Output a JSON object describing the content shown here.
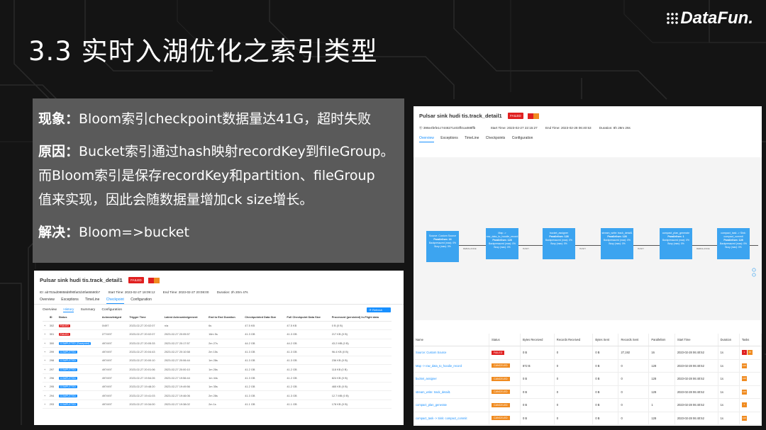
{
  "title": "3.3 实时入湖优化之索引类型",
  "logo": "DataFun.",
  "textbox": {
    "l1_label": "现象：",
    "l1_text": "Bloom索引checkpoint数据量达41G，超时失败",
    "l2_label": "原因：",
    "l2_text": "Bucket索引通过hash映射recordKey到fileGroup。",
    "l3": "而Bloom索引是保存recordKey和partition、fileGroup",
    "l4": "值来实现，因此会随数据量增加ck size增长。",
    "l5_label": "解决：",
    "l5_text": "Bloom=>bucket"
  },
  "panel_left": {
    "job_name": "Pulsar sink hudi tis.track_detail1",
    "status": "FAILED",
    "id": "ID: ab702ad08858d8f90fa01b0fa65580b7",
    "start": "Start Time: 2023-02-27 18:09:12",
    "end": "End Time: 2023-02-27 20:08:00",
    "duration": "Duration: 2h 20m 47s",
    "tabs": [
      "Overview",
      "Exceptions",
      "TimeLine",
      "Checkpoint",
      "Configuration"
    ],
    "subtabs": [
      "Overview",
      "History",
      "Summary",
      "Configuration"
    ],
    "refresh": "Refresh",
    "columns": [
      "ID",
      "Status",
      "Acknowledged",
      "Trigger Time",
      "Latest Acknowledgement",
      "End to End Duration",
      "Checkpointed Data Size",
      "Full Checkpoint Data Size",
      "Processed (persisted) In-Flight data"
    ],
    "rows": [
      [
        "302",
        "FAILED",
        "0/497",
        "2023-02-27 20:02:07",
        "n/a",
        "6s",
        "47.5 KB",
        "47.5 KB",
        "0 B (0 B)"
      ],
      [
        "301",
        "FAILED",
        "277/497",
        "2023-02-27 20:02:07",
        "2023-02-27 20:05:57",
        "16m 5s",
        "41.3 GB",
        "41.3 GB",
        "217 KB (0 B)"
      ],
      [
        "300",
        "COMPLETED (Savepoint)",
        "497/497",
        "2023-02-27 20:05:33",
        "2023-02-27 20:17:57",
        "2m 27s",
        "44.2 GB",
        "44.2 GB",
        "43.2 MB (0 B)"
      ],
      [
        "299",
        "COMPLETED",
        "497/497",
        "2023-02-27 20:04:43",
        "2023-02-27 20:10:58",
        "2m 15s",
        "41.3 GB",
        "41.3 GB",
        "96.4 KB (0 B)"
      ],
      [
        "298",
        "COMPLETED",
        "497/497",
        "2023-02-27 20:00:10",
        "2023-02-27 20:06:44",
        "1m 28s",
        "41.3 GB",
        "41.3 GB",
        "236 KB (0 B)"
      ],
      [
        "297",
        "COMPLETED",
        "497/497",
        "2023-02-27 20:01:06",
        "2023-02-27 20:00:10",
        "1m 26s",
        "41.2 GB",
        "41.2 GB",
        "118 KB (0 B)"
      ],
      [
        "296",
        "COMPLETED",
        "497/497",
        "2023-02-27 19:54:26",
        "2023-02-27 19:56:44",
        "1m 44s",
        "41.3 GB",
        "41.2 GB",
        "824 KB (0 B)"
      ],
      [
        "295",
        "COMPLETED",
        "497/497",
        "2023-02-27 19:48:20",
        "2023-02-27 19:49:56",
        "1m 35s",
        "41.2 GB",
        "41.2 GB",
        "465 KB (0 B)"
      ],
      [
        "294",
        "COMPLETED",
        "497/497",
        "2023-02-27 19:41:03",
        "2023-02-27 19:46:06",
        "2m 28s",
        "41.3 GB",
        "41.3 GB",
        "12.7 MB (0 B)"
      ],
      [
        "293",
        "COMPLETED",
        "497/497",
        "2023-02-27 19:34:00",
        "2023-02-27 19:38:02",
        "2m 1s",
        "41.1 GB",
        "41.1 GB",
        "178 KB (0 B)"
      ]
    ]
  },
  "panel_right": {
    "job_name": "Pulsar sink hudi tis.track_detail1",
    "status": "FAILED",
    "id": "396e4fefe1c7448271403ff4ca088ffb",
    "start": "Start Time: 2023-02-27 22:15:27",
    "end": "End Time: 2023-02-28 06:40:53",
    "duration": "Duration: 8h 28m 26s",
    "tabs": [
      "Overview",
      "Exceptions",
      "TimeLine",
      "Checkpoints",
      "Configuration"
    ],
    "nodes": [
      {
        "title": "Source: Custom Source",
        "par": "Parallelism: 16"
      },
      {
        "title": "Map -> row_data_to_hoodie_record",
        "par": "Parallelism: 128"
      },
      {
        "title": "bucket_assigner",
        "par": "Parallelism: 128"
      },
      {
        "title": "stream_write: track_detail1",
        "par": "Parallelism: 128"
      },
      {
        "title": "compact_plan_generate",
        "par": "Parallelism: 1"
      },
      {
        "title": "compact_task -> Sink: compact_commit",
        "par": "Parallelism: 128"
      }
    ],
    "node_sub": "Backpressured (max): 0%\nBusy (max): 0%",
    "edge_labels": [
      "REBALANCE",
      "HASH",
      "HASH",
      "HASH",
      "REBALANCE"
    ],
    "columns": [
      "Name",
      "Status",
      "Bytes Received",
      "Records Received",
      "Bytes Sent",
      "Records Sent",
      "Parallelism",
      "Start Time",
      "Duration",
      "Tasks"
    ],
    "rows": [
      [
        "Source: Custom Source",
        "FAILED",
        "0 B",
        "0",
        "0 B",
        "27,192",
        "16",
        "2023-02-28 06:40:52",
        "1s",
        "1|15"
      ],
      [
        "Map -> row_data_to_hoodie_record",
        "CANCELED",
        "872 B",
        "0",
        "0 B",
        "0",
        "128",
        "2023-02-28 06:40:52",
        "1s",
        "128"
      ],
      [
        "bucket_assigner",
        "CANCELED",
        "0 B",
        "0",
        "0 B",
        "0",
        "128",
        "2023-02-28 06:40:52",
        "1s",
        "128"
      ],
      [
        "stream_write: track_detail1",
        "CANCELED",
        "0 B",
        "0",
        "0 B",
        "0",
        "128",
        "2023-02-28 06:40:52",
        "1s",
        "128"
      ],
      [
        "compact_plan_generate",
        "CANCELED",
        "0 B",
        "0",
        "0 B",
        "0",
        "1",
        "2023-02-28 06:40:52",
        "1s",
        "1"
      ],
      [
        "compact_task -> Sink: compact_commit",
        "CANCELED",
        "0 B",
        "0",
        "0 B",
        "0",
        "128",
        "2023-02-28 06:40:52",
        "1s",
        "128"
      ]
    ]
  },
  "colors": {
    "failed": "#e02020",
    "completed": "#1890ff",
    "canceled": "#f08b20",
    "accent": "#1890ff"
  }
}
